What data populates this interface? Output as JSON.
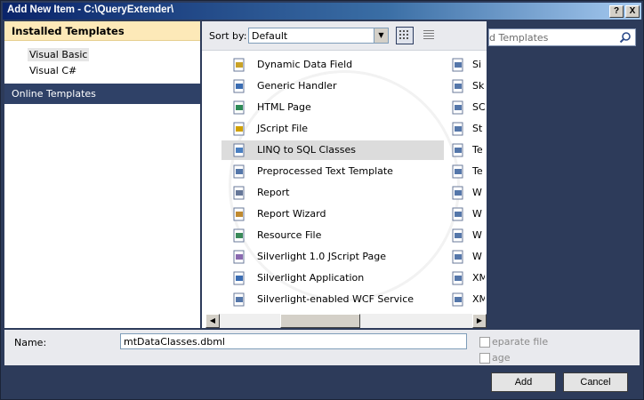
{
  "window": {
    "title": "Add New Item - C:\\QueryExtender\\",
    "help_label": "?",
    "close_label": "X"
  },
  "left_pane": {
    "installed_header": "Installed Templates",
    "tree_items": [
      "Visual Basic",
      "Visual C#"
    ],
    "online_header": "Online Templates"
  },
  "toolbar": {
    "sort_label": "Sort by:",
    "sort_value": "Default"
  },
  "templates": [
    {
      "label": "Dynamic Data Field",
      "icon": "dynamic-data-field-icon",
      "selected": false
    },
    {
      "label": "Generic Handler",
      "icon": "generic-handler-icon",
      "selected": false
    },
    {
      "label": "HTML Page",
      "icon": "html-page-icon",
      "selected": false
    },
    {
      "label": "JScript File",
      "icon": "jscript-file-icon",
      "selected": false
    },
    {
      "label": "LINQ to SQL Classes",
      "icon": "linq-to-sql-icon",
      "selected": true
    },
    {
      "label": "Preprocessed Text Template",
      "icon": "text-template-icon",
      "selected": false
    },
    {
      "label": "Report",
      "icon": "report-icon",
      "selected": false
    },
    {
      "label": "Report Wizard",
      "icon": "report-wizard-icon",
      "selected": false
    },
    {
      "label": "Resource File",
      "icon": "resource-file-icon",
      "selected": false
    },
    {
      "label": "Silverlight 1.0 JScript Page",
      "icon": "silverlight-jscript-icon",
      "selected": false
    },
    {
      "label": "Silverlight Application",
      "icon": "silverlight-app-icon",
      "selected": false
    },
    {
      "label": "Silverlight-enabled WCF Service",
      "icon": "wcf-service-icon",
      "selected": false
    }
  ],
  "templates_col2": [
    {
      "label": "Si"
    },
    {
      "label": "Sk"
    },
    {
      "label": "SC"
    },
    {
      "label": "St"
    },
    {
      "label": "Te"
    },
    {
      "label": "Te"
    },
    {
      "label": "W"
    },
    {
      "label": "W"
    },
    {
      "label": "W"
    },
    {
      "label": "W"
    },
    {
      "label": "XM"
    },
    {
      "label": "XM"
    }
  ],
  "search": {
    "text": "d Templates"
  },
  "bottom": {
    "name_label": "Name:",
    "name_value": "mtDataClasses.dbml",
    "chk1_label": "eparate file",
    "chk2_label": "age"
  },
  "buttons": {
    "add": "Add",
    "cancel": "Cancel"
  }
}
